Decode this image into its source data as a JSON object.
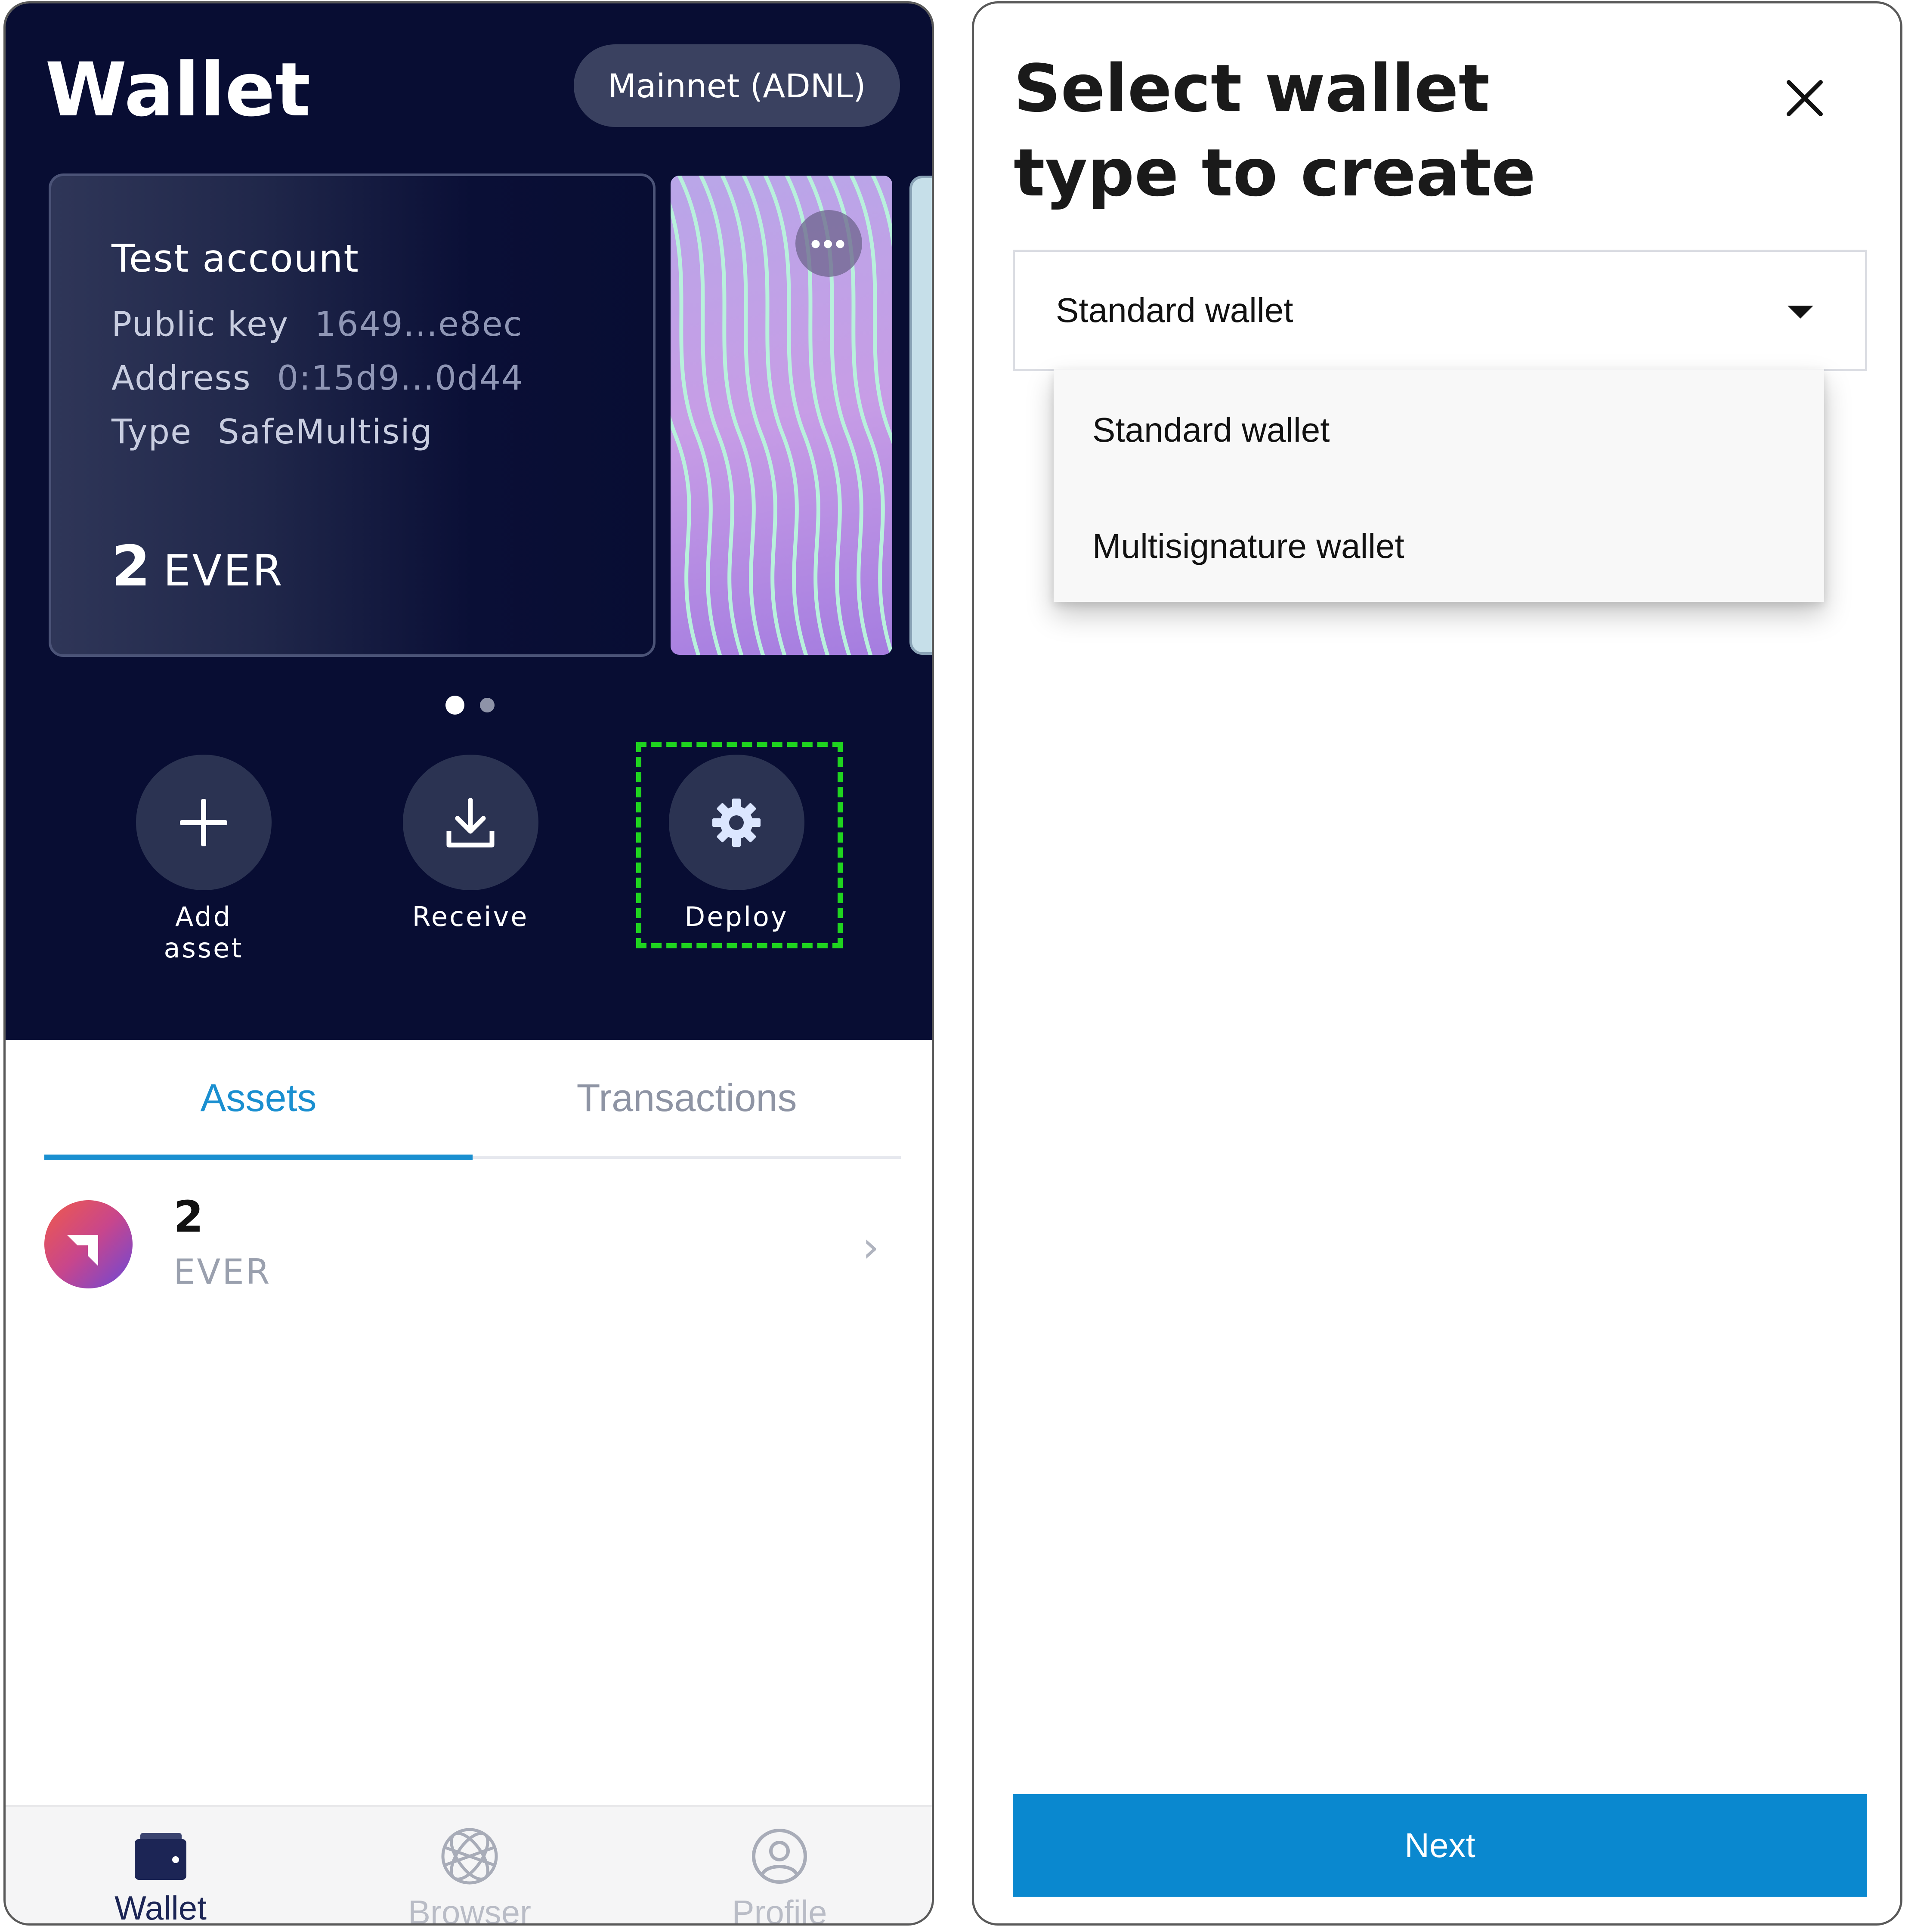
{
  "left": {
    "header": {
      "title": "Wallet",
      "network": "Mainnet (ADNL)"
    },
    "account": {
      "name": "Test account",
      "public_key_label": "Public key",
      "public_key_value": "1649...e8ec",
      "address_label": "Address",
      "address_value": "0:15d9...0d44",
      "type_label": "Type",
      "type_value": "SafeMultisig",
      "balance_amount": "2",
      "balance_unit": "EVER"
    },
    "nft_more_icon": "ellipsis-icon",
    "actions": [
      {
        "label": "Add asset",
        "icon": "plus-icon"
      },
      {
        "label": "Receive",
        "icon": "download-icon"
      },
      {
        "label": "Deploy",
        "icon": "gear-icon"
      }
    ],
    "highlight_color": "#1fd41f",
    "tabs": [
      {
        "label": "Assets",
        "active": true
      },
      {
        "label": "Transactions",
        "active": false
      }
    ],
    "assets": [
      {
        "amount": "2",
        "symbol": "EVER",
        "icon": "ever-logo-icon"
      }
    ],
    "bottom_nav": [
      {
        "label": "Wallet",
        "icon": "wallet-icon",
        "active": true
      },
      {
        "label": "Browser",
        "icon": "globe-icon",
        "active": false
      },
      {
        "label": "Profile",
        "icon": "profile-icon",
        "active": false
      }
    ],
    "colors": {
      "header_bg": "#080d33",
      "accent": "#1a8fd0"
    }
  },
  "right": {
    "title": "Select wallet type to create",
    "select": {
      "value": "Standard wallet"
    },
    "dropdown": {
      "options": [
        "Standard wallet",
        "Multisignature wallet"
      ]
    },
    "next_label": "Next",
    "colors": {
      "button": "#0a88cf"
    }
  }
}
